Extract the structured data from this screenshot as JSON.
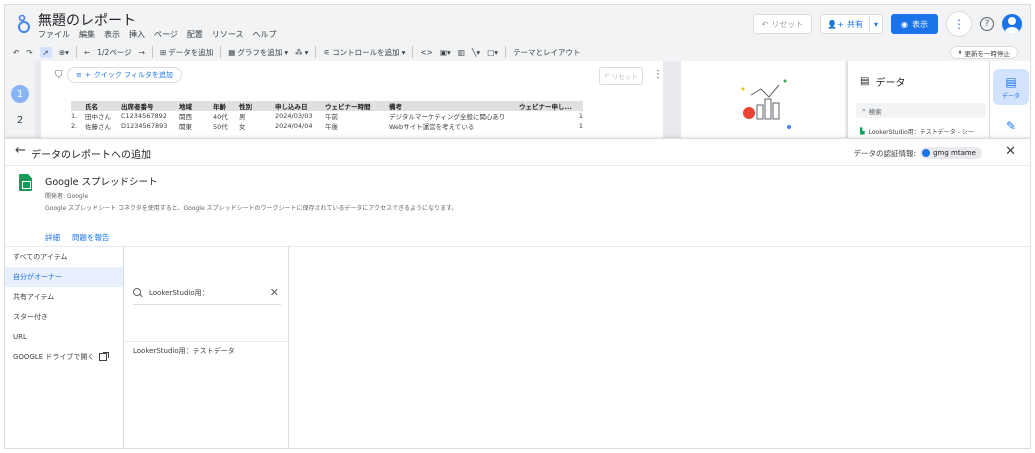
{
  "app": {
    "title": "無題のレポート",
    "menu": [
      "ファイル",
      "編集",
      "表示",
      "挿入",
      "ページ",
      "配置",
      "リソース",
      "ヘルプ"
    ]
  },
  "header_actions": {
    "reset_label": "リセット",
    "share_label": "共有",
    "view_label": "表示"
  },
  "toolbar": {
    "page_label": "1/2ページ",
    "add_data": "データを追加",
    "add_chart": "グラフを追加",
    "add_control": "コントロールを追加",
    "theme_layout": "テーマとレイアウト",
    "pause_updates": "更新を一時停止"
  },
  "canvas": {
    "pages": [
      "1",
      "2"
    ],
    "quick_filter": "クイック フィルタを追加",
    "reset_mini": "リセット",
    "table": {
      "headers": [
        "",
        "氏名",
        "出席者番号",
        "地域",
        "年齢",
        "性別",
        "申し込み日",
        "ウェビナー時間",
        "備考",
        "ウェビナー申し..."
      ],
      "rows": [
        [
          "1.",
          "田中さん",
          "C1234567892",
          "関西",
          "40代",
          "男",
          "2024/03/03",
          "午前",
          "デジタルマーケティング全般に関心あり",
          "1"
        ],
        [
          "2.",
          "佐藤さん",
          "D1234567893",
          "関東",
          "50代",
          "女",
          "2024/04/04",
          "午後",
          "Webサイト運営を考えている",
          "1"
        ]
      ]
    }
  },
  "data_panel": {
    "title": "データ",
    "search_placeholder": "検索",
    "source_name": "LookerStudio用：テストデータ - シー"
  },
  "right_rail": {
    "data_label": "データ"
  },
  "overlay": {
    "title": "データのレポートへの追加",
    "credentials_label": "データの認証情報:",
    "credentials_user": "gmg mtame",
    "connector": {
      "name": "Google スプレッドシート",
      "developer": "開発者: Google",
      "description": "Google スプレッドシート コネクタを使用すると、Google スプレッドシートのワークシートに保存されているデータにアクセスできるようになります。",
      "links": [
        "詳細",
        "問題を報告"
      ]
    },
    "nav": [
      {
        "label": "すべてのアイテム",
        "active": false
      },
      {
        "label": "自分がオーナー",
        "active": true
      },
      {
        "label": "共有アイテム",
        "active": false
      },
      {
        "label": "スター付き",
        "active": false
      },
      {
        "label": "URL",
        "active": false
      },
      {
        "label": "GOOGLE ドライブで開く",
        "active": false
      }
    ],
    "search_value": "LookerStudio用：",
    "results": [
      "LookerStudio用：テストデータ"
    ]
  },
  "colors": {
    "accent": "#1a73e8",
    "sheets_green": "#0f9d58",
    "nav_active_bg": "#e8f0fe"
  },
  "icons": [
    "lookerstudio-logo-icon",
    "undo-icon",
    "redo-icon",
    "select-icon",
    "zoom-icon",
    "back-icon",
    "forward-icon",
    "add-data-icon",
    "add-chart-icon",
    "community-viz-icon",
    "add-control-icon",
    "code-icon",
    "image-icon",
    "line-icon",
    "shape-icon",
    "filter-icon",
    "search-icon",
    "close-icon",
    "sheets-icon",
    "open-external-icon",
    "help-icon",
    "avatar"
  ]
}
